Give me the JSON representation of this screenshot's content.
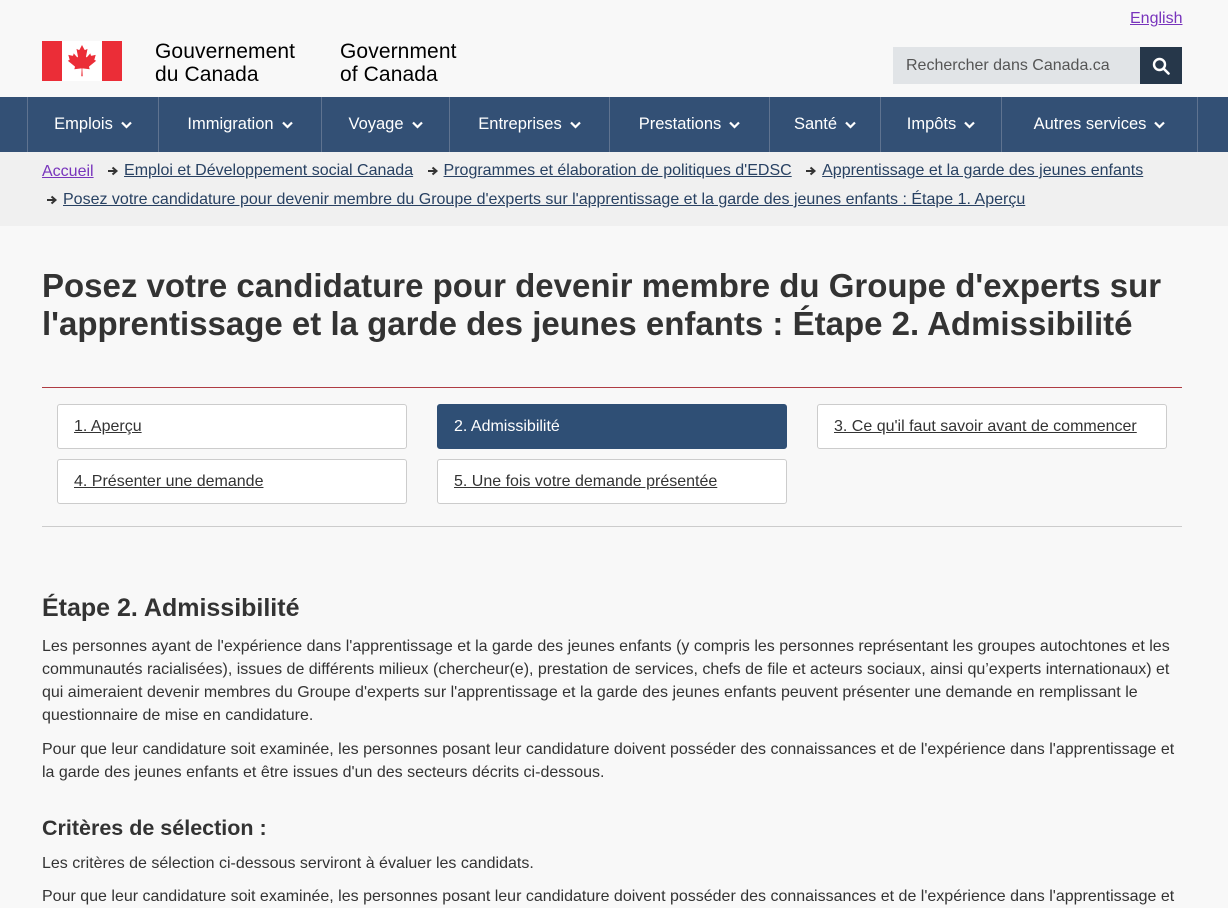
{
  "header": {
    "language_link": "English",
    "signature_fr": "Gouvernement\ndu Canada",
    "signature_en": "Government\nof Canada",
    "search_placeholder": "Rechercher dans Canada.ca",
    "search_icon": "search-icon"
  },
  "menu": {
    "items": [
      {
        "label": "Emplois"
      },
      {
        "label": "Immigration"
      },
      {
        "label": "Voyage"
      },
      {
        "label": "Entreprises"
      },
      {
        "label": "Prestations"
      },
      {
        "label": "Santé"
      },
      {
        "label": "Impôts"
      },
      {
        "label": "Autres services"
      }
    ]
  },
  "breadcrumb": {
    "items": [
      "Accueil",
      "Emploi et Développement social Canada",
      "Programmes et élaboration de politiques d'EDSC",
      "Apprentissage et la garde des jeunes enfants",
      "Posez votre candidature pour devenir membre du Groupe d'experts sur l'apprentissage et la garde des jeunes enfants : Étape 1. Aperçu"
    ]
  },
  "main": {
    "title": "Posez votre candidature pour devenir membre du Groupe d'experts sur l'apprentissage et la garde des jeunes enfants : Étape 2. Admissibilité",
    "steps": [
      {
        "label": "1. Aperçu",
        "active": false
      },
      {
        "label": "2. Admissibilité",
        "active": true
      },
      {
        "label": "3. Ce qu'il faut savoir avant de commencer",
        "active": false
      },
      {
        "label": "4. Présenter une demande",
        "active": false
      },
      {
        "label": "5. Une fois votre demande présentée",
        "active": false
      }
    ],
    "section_heading": "Étape 2. Admissibilité",
    "paragraph1": "Les personnes ayant de l'expérience dans l'apprentissage et la garde des jeunes enfants (y compris les personnes représentant les groupes autochtones et les communautés racialisées), issues de différents milieux (chercheur(e), prestation de services, chefs de file et acteurs sociaux, ainsi qu’experts internationaux) et qui aimeraient devenir membres du Groupe d'experts sur l'apprentissage et la garde des jeunes enfants peuvent présenter une demande en remplissant le questionnaire de mise en candidature.",
    "paragraph2": "Pour que leur candidature soit examinée, les personnes posant leur candidature doivent posséder des connaissances et de l'expérience dans l'apprentissage et la garde des jeunes enfants et être issues d'un des secteurs décrits ci-dessous.",
    "criteria_heading": "Critères de sélection :",
    "paragraph3": "Les critères de sélection ci-dessous serviront à évaluer les candidats.",
    "paragraph4": "Pour que leur candidature soit examinée, les personnes posant leur candidature doivent posséder des connaissances et de l'expérience dans l'apprentissage et"
  },
  "colors": {
    "menu_bg": "#335075",
    "active_step": "#2f4f75",
    "visited_link": "#7834bc",
    "title_rule": "#af3c43"
  }
}
